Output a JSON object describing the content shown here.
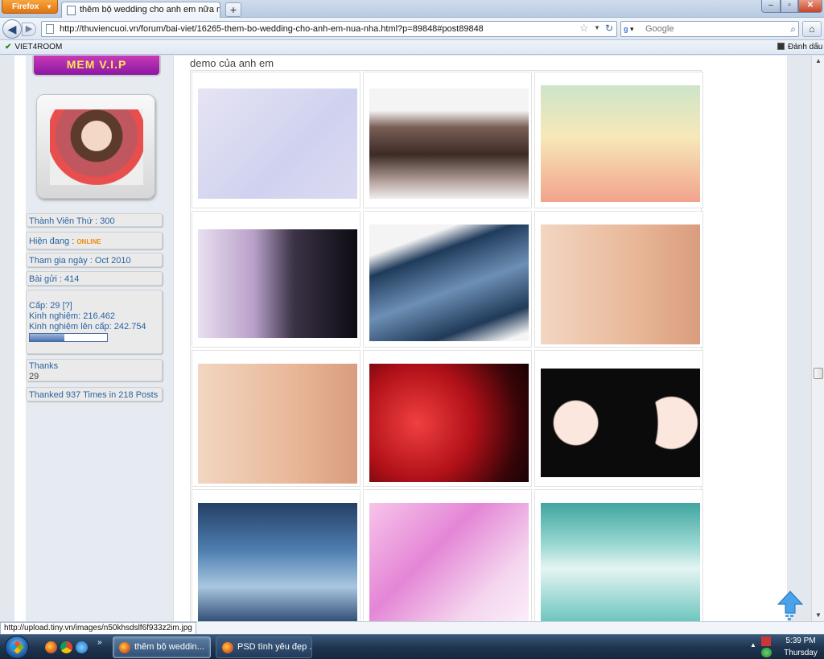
{
  "browser": {
    "app_button": "Firefox",
    "tab_title": "thêm bộ wedding cho anh em nữa nha",
    "new_tab": "+",
    "url": "http://thuviencuoi.vn/forum/bai-viet/16265-them-bo-wedding-cho-anh-em-nua-nha.html?p=89848#post89848",
    "search_placeholder": "Google",
    "search_engine_label": "g",
    "bookmarks": [
      "VIET4ROOM",
      "Đánh dấu"
    ],
    "status_url": "http://upload.tiny.vn/images/n50khsdslf6f933z2im.jpg"
  },
  "sidebar": {
    "vip_badge": "MEM V.I.P",
    "member_number": "Thành Viên Thứ : 300",
    "status_label": "Hiện đang : ",
    "status_value": "ONLINE",
    "join_date": "Tham gia ngày : Oct 2010",
    "posts": "Bài gửi : 414",
    "level": "Cấp: 29 [?]",
    "experience": "Kinh nghiệm: 216.462",
    "next_level": "Kinh nghiệm lên cấp: 242.754",
    "xp_progress": 0.45,
    "thanks_label": "Thanks",
    "thanks_count": "29",
    "thanked": "Thanked 937 Times in 218 Posts"
  },
  "content": {
    "title": "demo của anh em"
  },
  "taskbar": {
    "tasks": [
      "thêm bộ weddin...",
      "PSD tình yêu đẹp ..."
    ],
    "time": "5:39 PM",
    "day": "Thursday"
  },
  "colors": {
    "link_blue": "#2a63a2",
    "online_orange": "#f08a0a",
    "firefox_orange": "#e07413"
  }
}
